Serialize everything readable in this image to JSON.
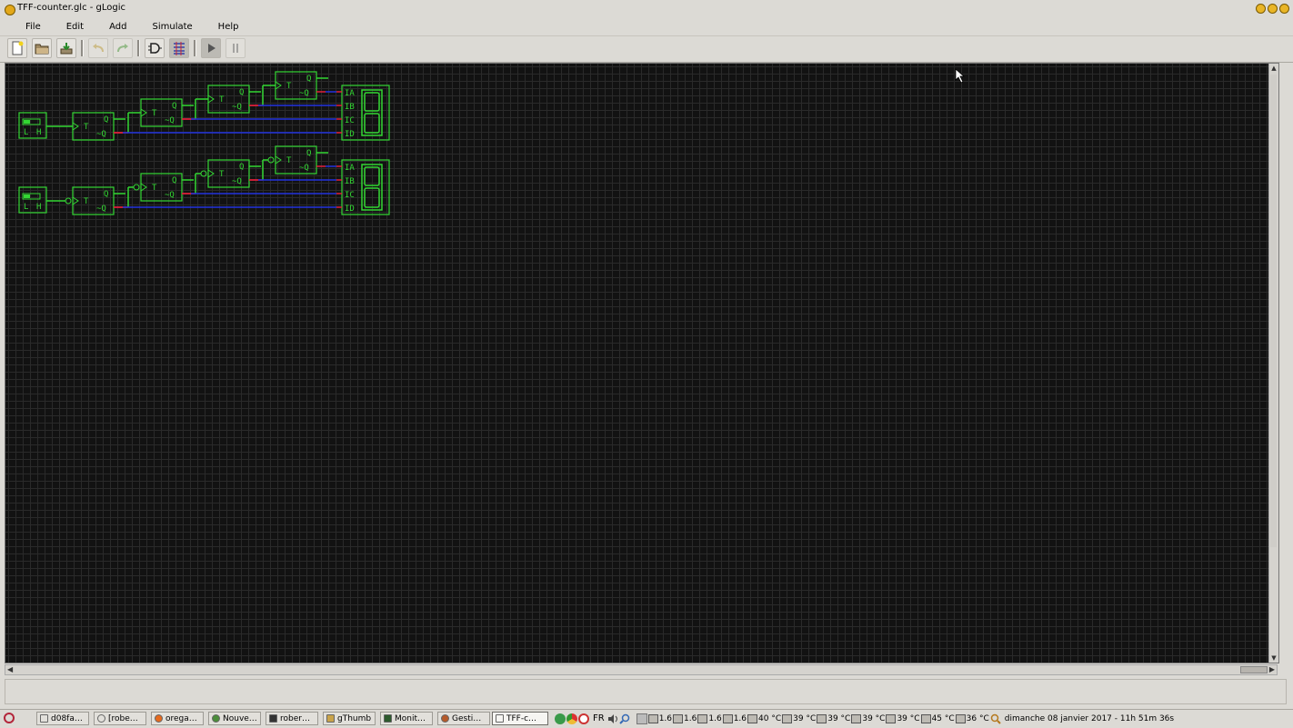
{
  "window": {
    "title": "TFF-counter.glc - gLogic"
  },
  "menu": [
    "File",
    "Edit",
    "Add",
    "Simulate",
    "Help"
  ],
  "toolbar": {
    "buttons": [
      "new-file",
      "open-file",
      "save-file",
      "undo",
      "redo",
      "gate-view",
      "component-view",
      "run-simulation",
      "pause-simulation"
    ]
  },
  "circuit": {
    "switch_labels": [
      "L",
      "H"
    ],
    "tff_label": "T",
    "q_label": "Q",
    "nq_label": "~Q",
    "display_inputs": [
      "IA",
      "IB",
      "IC",
      "ID"
    ]
  },
  "status": {
    "text": ""
  },
  "taskbar": {
    "tasks": [
      "d08fa…",
      "[robe…",
      "orega…",
      "Nouve…",
      "rober…",
      "gThumb",
      "Monit…",
      "Gesti…",
      "TFF-c…"
    ],
    "active_task": "TFF-c…",
    "keyboard_layout": "FR",
    "load_values": [
      "1.6",
      "1.6",
      "1.6",
      "1.6"
    ],
    "temperatures": [
      "40 °C",
      "39 °C",
      "39 °C",
      "39 °C",
      "39 °C",
      "45 °C",
      "36 °C"
    ],
    "clock": "dimanche 08 janvier 2017 - 11h 51m 36s"
  },
  "colors": {
    "canvas_bg": "#121212",
    "grid": "#2a2a2a",
    "component": "#33d633",
    "wire_blue": "#2233dd",
    "wire_red": "#e0203a"
  }
}
